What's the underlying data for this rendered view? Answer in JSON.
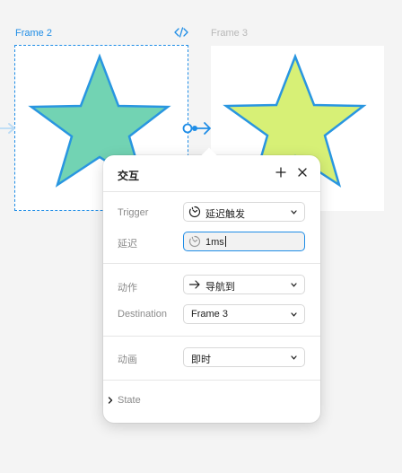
{
  "canvas": {
    "frame2_label": "Frame 2",
    "frame3_label": "Frame 3"
  },
  "colors": {
    "selection": "#1f8de6",
    "star_outline": "#2996e0",
    "star2_fill": "#72d3b3",
    "star3_fill": "#d7f076"
  },
  "icons": [
    "code-icon",
    "star-shape",
    "prototype-connector",
    "plus-icon",
    "close-icon",
    "delay-clock-icon",
    "arrow-right-icon",
    "chevron-down-icon",
    "chevron-right-icon"
  ],
  "panel": {
    "title": "交互",
    "trigger": {
      "label": "Trigger",
      "value": "延迟触发"
    },
    "delay": {
      "label": "延迟",
      "value": "1ms"
    },
    "action": {
      "label": "动作",
      "value": "导航到"
    },
    "destination": {
      "label": "Destination",
      "value": "Frame 3"
    },
    "animation": {
      "label": "动画",
      "value": "即时"
    },
    "state": {
      "label": "State"
    }
  }
}
